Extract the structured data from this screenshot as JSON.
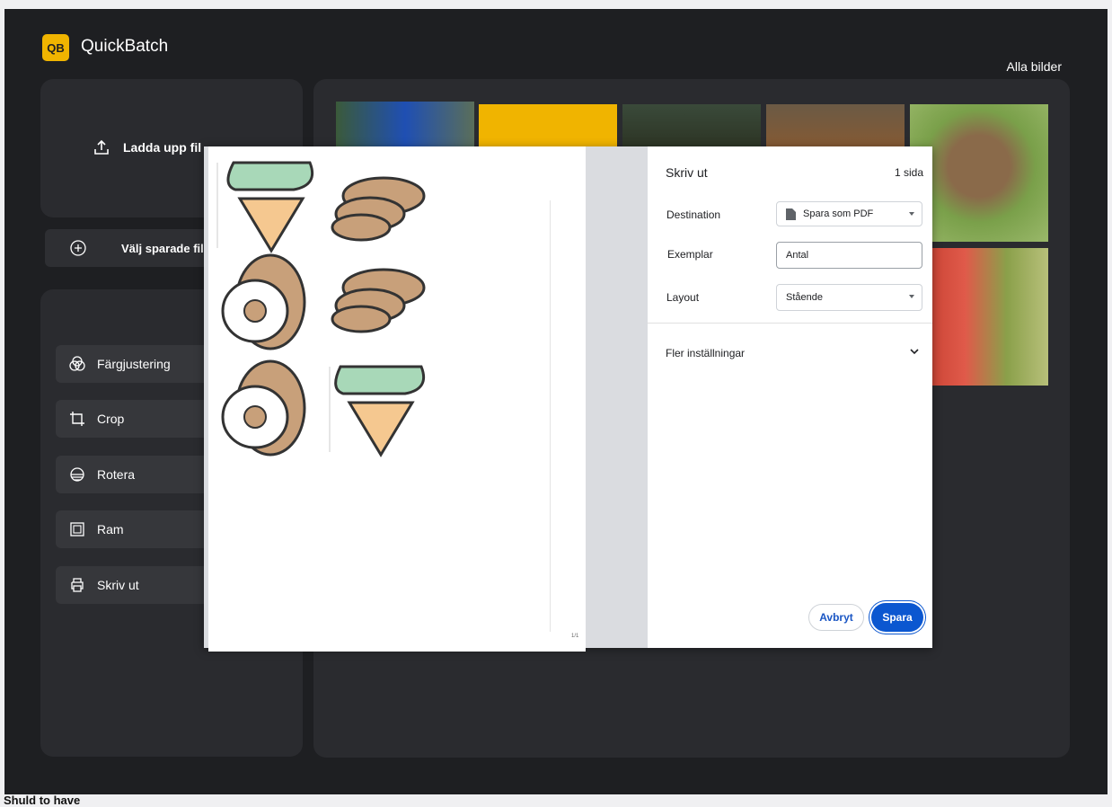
{
  "app": {
    "logo": "QB",
    "brand": "QuickBatch",
    "view_all": "Alla bilder"
  },
  "sidebar": {
    "upload_label": "Ladda upp fil",
    "saved_label": "Välj sparade fil",
    "tools": [
      {
        "label": "Färgjustering",
        "icon": "color-wheel-icon"
      },
      {
        "label": "Crop",
        "icon": "crop-icon"
      },
      {
        "label": "Rotera",
        "icon": "horizon-icon"
      },
      {
        "label": "Ram",
        "icon": "frame-icon"
      },
      {
        "label": "Skriv ut",
        "icon": "printer-icon"
      }
    ]
  },
  "print_dialog": {
    "title": "Skriv ut",
    "page_count": "1 sida",
    "destination_label": "Destination",
    "destination_value": "Spara som PDF",
    "copies_label": "Exemplar",
    "copies_placeholder": "Antal",
    "layout_label": "Layout",
    "layout_value": "Stående",
    "more_settings": "Fler inställningar",
    "cancel": "Avbryt",
    "save": "Spara",
    "page_number": "1/1"
  },
  "footer_text": "Shuld to have"
}
